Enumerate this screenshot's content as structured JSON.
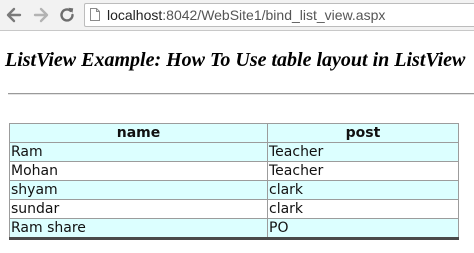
{
  "browser": {
    "url_host": "localhost",
    "url_rest": ":8042/WebSite1/bind_list_view.aspx",
    "icons": [
      "back-arrow-icon",
      "forward-arrow-icon",
      "reload-icon",
      "page-icon"
    ]
  },
  "page": {
    "heading": "ListView Example: How To Use table layout in ListView"
  },
  "table": {
    "headers": [
      "name",
      "post"
    ],
    "rows": [
      [
        "Ram",
        "Teacher"
      ],
      [
        "Mohan",
        "Teacher"
      ],
      [
        "shyam",
        "clark"
      ],
      [
        "sundar",
        "clark"
      ],
      [
        "Ram share",
        "PO"
      ]
    ],
    "colors": {
      "stripe": "#dcffff",
      "plain": "#ffffff"
    }
  }
}
